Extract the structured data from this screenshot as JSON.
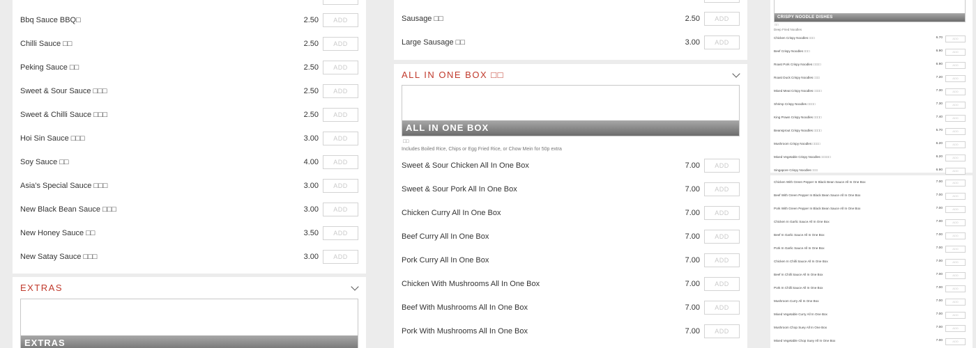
{
  "col1": {
    "items": [
      {
        "name": "Bbq Sauce BBQ□",
        "price": "2.50"
      },
      {
        "name": "Chilli Sauce □□",
        "price": "2.50"
      },
      {
        "name": "Peking Sauce □□",
        "price": "2.50"
      },
      {
        "name": "Sweet & Sour Sauce □□□",
        "price": "2.50"
      },
      {
        "name": "Sweet & Chilli Sauce □□□",
        "price": "2.50"
      },
      {
        "name": "Hoi Sin Sauce □□□",
        "price": "3.00"
      },
      {
        "name": "Soy Sauce □□",
        "price": "4.00"
      },
      {
        "name": "Asia's Special Sauce □□□",
        "price": "3.00"
      },
      {
        "name": "New Black Bean Sauce □□□",
        "price": "3.00"
      },
      {
        "name": "New Honey Sauce □□",
        "price": "3.50"
      },
      {
        "name": "New Satay Sauce □□□",
        "price": "3.00"
      }
    ],
    "extras_section": {
      "title": "EXTRAS",
      "banner_title": "EXTRAS"
    }
  },
  "col2": {
    "top_items": [
      {
        "name": "Sausage □□",
        "price": "2.50"
      },
      {
        "name": "Large Sausage □□",
        "price": "3.00"
      }
    ],
    "section": {
      "title": "ALL IN ONE BOX □□",
      "banner_title": "ALL IN ONE BOX",
      "cn": "□□",
      "description": "Includes Boiled Rice, Chips or Egg Fried Rice, or Chow Mein for 50p extra"
    },
    "items": [
      {
        "name": "Sweet & Sour Chicken All In One Box",
        "price": "7.00"
      },
      {
        "name": "Sweet & Sour Pork All In One Box",
        "price": "7.00"
      },
      {
        "name": "Chicken Curry All In One Box",
        "price": "7.00"
      },
      {
        "name": "Beef Curry All In One Box",
        "price": "7.00"
      },
      {
        "name": "Pork Curry All In One Box",
        "price": "7.00"
      },
      {
        "name": "Chicken With Mushrooms All In One Box",
        "price": "7.00"
      },
      {
        "name": "Beef With Mushrooms All In One Box",
        "price": "7.00"
      },
      {
        "name": "Pork With Mushrooms All In One Box",
        "price": "7.00"
      }
    ]
  },
  "col3": {
    "banner_title": "CRISPY NOODLE DISHES",
    "cn": "□□",
    "description": "Deep Fried Noodles",
    "items": [
      {
        "name": "Chicken Crispy Noodles □□□",
        "price": "6.70"
      },
      {
        "name": "Beef Crispy Noodles □□□",
        "price": "6.90"
      },
      {
        "name": "Roast Pork Crispy Noodles □□□□",
        "price": "6.90"
      },
      {
        "name": "Roast Duck Crispy Noodles □□□",
        "price": "7.20"
      },
      {
        "name": "Mixed Meat Crispy Noodles □□□□",
        "price": "7.30"
      },
      {
        "name": "Shrimp Crispy Noodles □□□□",
        "price": "7.30"
      },
      {
        "name": "King Prawn Crispy Noodles □□□□",
        "price": "7.40"
      },
      {
        "name": "Beansprout Crispy Noodles □□□□",
        "price": "5.70"
      },
      {
        "name": "Mushroom Crispy Noodles □□□□",
        "price": "6.20"
      },
      {
        "name": "Mixed Vegetable Crispy Noodles □□□□□",
        "price": "6.20"
      },
      {
        "name": "Singapore Crispy Noodles □□□",
        "price": "6.90"
      }
    ],
    "box_items": [
      {
        "name": "Chicken With Green Pepper In Black Bean Sauce All In One Box",
        "price": "7.00"
      },
      {
        "name": "Beef With Green Pepper In Black Bean Sauce All In One Box",
        "price": "7.00"
      },
      {
        "name": "Pork With Green Pepper In Black Bean Sauce All In One Box",
        "price": "7.00"
      },
      {
        "name": "Chicken In Garlic Sauce All In One Box",
        "price": "7.00"
      },
      {
        "name": "Beef In Garlic Sauce All In One Box",
        "price": "7.00"
      },
      {
        "name": "Pork In Garlic Sauce All In One Box",
        "price": "7.00"
      },
      {
        "name": "Chicken In Chilli Sauce All In One Box",
        "price": "7.00"
      },
      {
        "name": "Beef In Chilli Sauce All In One Box",
        "price": "7.00"
      },
      {
        "name": "Pork In Chilli Sauce All In One Box",
        "price": "7.00"
      },
      {
        "name": "Mushroom Curry All In One Box",
        "price": "7.00"
      },
      {
        "name": "Mixed Vegetable Curry All In One Box",
        "price": "7.00"
      },
      {
        "name": "Mushroom Chop Suey All In One Box",
        "price": "7.00"
      },
      {
        "name": "Mixed Vegetable Chop Suey All In One Box",
        "price": "7.00"
      }
    ]
  },
  "add_label": "ADD",
  "colors": {
    "accent": "#c0392b",
    "background": "#ececec",
    "card": "#ffffff"
  }
}
